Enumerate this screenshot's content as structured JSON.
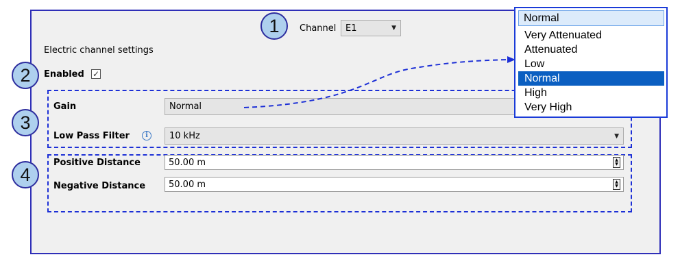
{
  "callouts": [
    "1",
    "2",
    "3",
    "4"
  ],
  "channel": {
    "label": "Channel",
    "value": "E1"
  },
  "section_title": "Electric channel settings",
  "enabled": {
    "label": "Enabled",
    "checked": true,
    "check_glyph": "✓"
  },
  "gain": {
    "label": "Gain",
    "value": "Normal"
  },
  "low_pass": {
    "label": "Low Pass Filter",
    "info_glyph": "i",
    "value": "10 kHz"
  },
  "positive_distance": {
    "label": "Positive Distance",
    "value": "50.00 m"
  },
  "negative_distance": {
    "label": "Negative Distance",
    "value": "50.00 m"
  },
  "gain_dropdown": {
    "current": "Normal",
    "options": [
      "Very Attenuated",
      "Attenuated",
      "Low",
      "Normal",
      "High",
      "Very High"
    ],
    "highlighted_index": 3
  },
  "colors": {
    "callout_fill": "#aed0ee",
    "dash": "#1c2fd6",
    "highlight": "#0b5fc1"
  }
}
